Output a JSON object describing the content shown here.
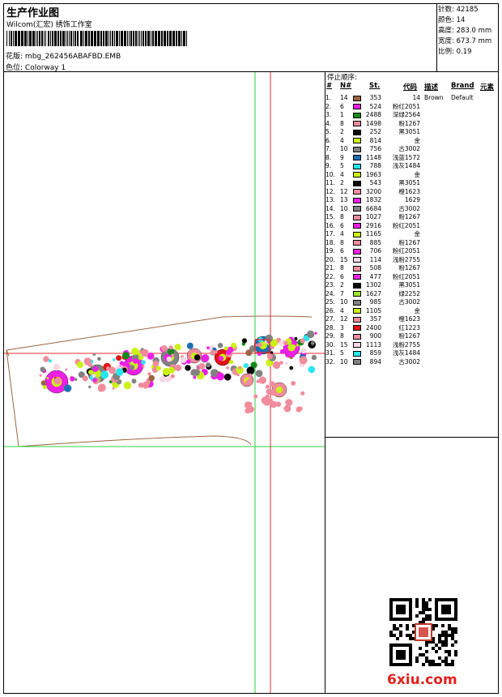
{
  "header": {
    "title": "生产作业图",
    "company": "Wilcom(汇宏) 绣饰工作室",
    "design_label": "花版:",
    "design_value": "mbg_262456ABAFBD.EMB",
    "colorway_label": "色位:",
    "colorway_value": "Colorway 1"
  },
  "stats": {
    "stitches": "针数: 42185",
    "colors": "颜色: 14",
    "height": "高度: 283.0 mm",
    "width": "宽度: 673.7 mm",
    "scale": "比例: 0.19"
  },
  "sequence": {
    "title": "停止顺序:",
    "headers": {
      "idx": "#",
      "n": "N#",
      "st": "St.",
      "code": "代码",
      "desc": "描述",
      "brand": "Brand",
      "elem": "元素"
    },
    "rows": [
      {
        "idx": "1.",
        "n": "14",
        "color": "#9a6440",
        "st": "353",
        "code": "14",
        "desc": "Brown",
        "brand": "Default"
      },
      {
        "idx": "2.",
        "n": "6",
        "color": "#ee1ee6",
        "st": "524",
        "code": "粉红2051",
        "desc": "",
        "brand": ""
      },
      {
        "idx": "3.",
        "n": "1",
        "color": "#128a18",
        "st": "2488",
        "code": "深绿2564",
        "desc": "",
        "brand": ""
      },
      {
        "idx": "4.",
        "n": "8",
        "color": "#f08c9c",
        "st": "1498",
        "code": "粉1267",
        "desc": "",
        "brand": ""
      },
      {
        "idx": "5.",
        "n": "2",
        "color": "#0a0a0a",
        "st": "252",
        "code": "黑3051",
        "desc": "",
        "brand": ""
      },
      {
        "idx": "6.",
        "n": "4",
        "color": "#ccf014",
        "st": "814",
        "code": "金",
        "desc": "",
        "brand": ""
      },
      {
        "idx": "7.",
        "n": "10",
        "color": "#828282",
        "st": "756",
        "code": "古3002",
        "desc": "",
        "brand": ""
      },
      {
        "idx": "8.",
        "n": "9",
        "color": "#1e6eb4",
        "st": "1148",
        "code": "浅蓝1572",
        "desc": "",
        "brand": ""
      },
      {
        "idx": "9.",
        "n": "5",
        "color": "#28e6f0",
        "st": "788",
        "code": "浅灰1484",
        "desc": "",
        "brand": ""
      },
      {
        "idx": "10.",
        "n": "4",
        "color": "#ccf014",
        "st": "1963",
        "code": "金",
        "desc": "",
        "brand": ""
      },
      {
        "idx": "11.",
        "n": "2",
        "color": "#0a0a0a",
        "st": "543",
        "code": "黑3051",
        "desc": "",
        "brand": ""
      },
      {
        "idx": "12.",
        "n": "12",
        "color": "#f08c9c",
        "st": "3200",
        "code": "橙1623",
        "desc": "",
        "brand": ""
      },
      {
        "idx": "13.",
        "n": "13",
        "color": "#ee1ee6",
        "st": "1832",
        "code": "1629",
        "desc": "",
        "brand": ""
      },
      {
        "idx": "14.",
        "n": "10",
        "color": "#828282",
        "st": "6684",
        "code": "古3002",
        "desc": "",
        "brand": ""
      },
      {
        "idx": "15.",
        "n": "8",
        "color": "#f08c9c",
        "st": "1027",
        "code": "粉1267",
        "desc": "",
        "brand": ""
      },
      {
        "idx": "16.",
        "n": "6",
        "color": "#ee1ee6",
        "st": "2916",
        "code": "粉红2051",
        "desc": "",
        "brand": ""
      },
      {
        "idx": "17.",
        "n": "4",
        "color": "#ccf014",
        "st": "1165",
        "code": "金",
        "desc": "",
        "brand": ""
      },
      {
        "idx": "18.",
        "n": "8",
        "color": "#f08c9c",
        "st": "885",
        "code": "粉1267",
        "desc": "",
        "brand": ""
      },
      {
        "idx": "19.",
        "n": "6",
        "color": "#ee1ee6",
        "st": "706",
        "code": "粉红2051",
        "desc": "",
        "brand": ""
      },
      {
        "idx": "20.",
        "n": "15",
        "color": "#f8d8e6",
        "st": "114",
        "code": "浅粉2755",
        "desc": "",
        "brand": ""
      },
      {
        "idx": "21.",
        "n": "8",
        "color": "#f08c9c",
        "st": "508",
        "code": "粉1267",
        "desc": "",
        "brand": ""
      },
      {
        "idx": "22.",
        "n": "6",
        "color": "#ee1ee6",
        "st": "477",
        "code": "粉红2051",
        "desc": "",
        "brand": ""
      },
      {
        "idx": "23.",
        "n": "2",
        "color": "#0a0a0a",
        "st": "1302",
        "code": "黑3051",
        "desc": "",
        "brand": ""
      },
      {
        "idx": "24.",
        "n": "7",
        "color": "#a0e632",
        "st": "1627",
        "code": "绿2252",
        "desc": "",
        "brand": ""
      },
      {
        "idx": "25.",
        "n": "10",
        "color": "#828282",
        "st": "985",
        "code": "古3002",
        "desc": "",
        "brand": ""
      },
      {
        "idx": "26.",
        "n": "4",
        "color": "#ccf014",
        "st": "1105",
        "code": "金",
        "desc": "",
        "brand": ""
      },
      {
        "idx": "27.",
        "n": "12",
        "color": "#f08c9c",
        "st": "357",
        "code": "橙1623",
        "desc": "",
        "brand": ""
      },
      {
        "idx": "28.",
        "n": "3",
        "color": "#e01414",
        "st": "2400",
        "code": "红1223",
        "desc": "",
        "brand": ""
      },
      {
        "idx": "29.",
        "n": "8",
        "color": "#f08c9c",
        "st": "900",
        "code": "粉1267",
        "desc": "",
        "brand": ""
      },
      {
        "idx": "30.",
        "n": "15",
        "color": "#f8d8e6",
        "st": "1113",
        "code": "浅粉2755",
        "desc": "",
        "brand": ""
      },
      {
        "idx": "31.",
        "n": "5",
        "color": "#28e6f0",
        "st": "859",
        "code": "浅灰1484",
        "desc": "",
        "brand": ""
      },
      {
        "idx": "32.",
        "n": "10",
        "color": "#828282",
        "st": "894",
        "code": "古3002",
        "desc": "",
        "brand": ""
      }
    ]
  },
  "colors": {
    "guide_red": "#e8282c",
    "guide_green": "#2ad13a",
    "outline_brown": "#9a6440",
    "logo_red": "#e2211c"
  },
  "icons": {
    "qr": "qr-code-icon",
    "seal": "red-seal-stamp-icon"
  },
  "logo_text": "6xiu.com"
}
